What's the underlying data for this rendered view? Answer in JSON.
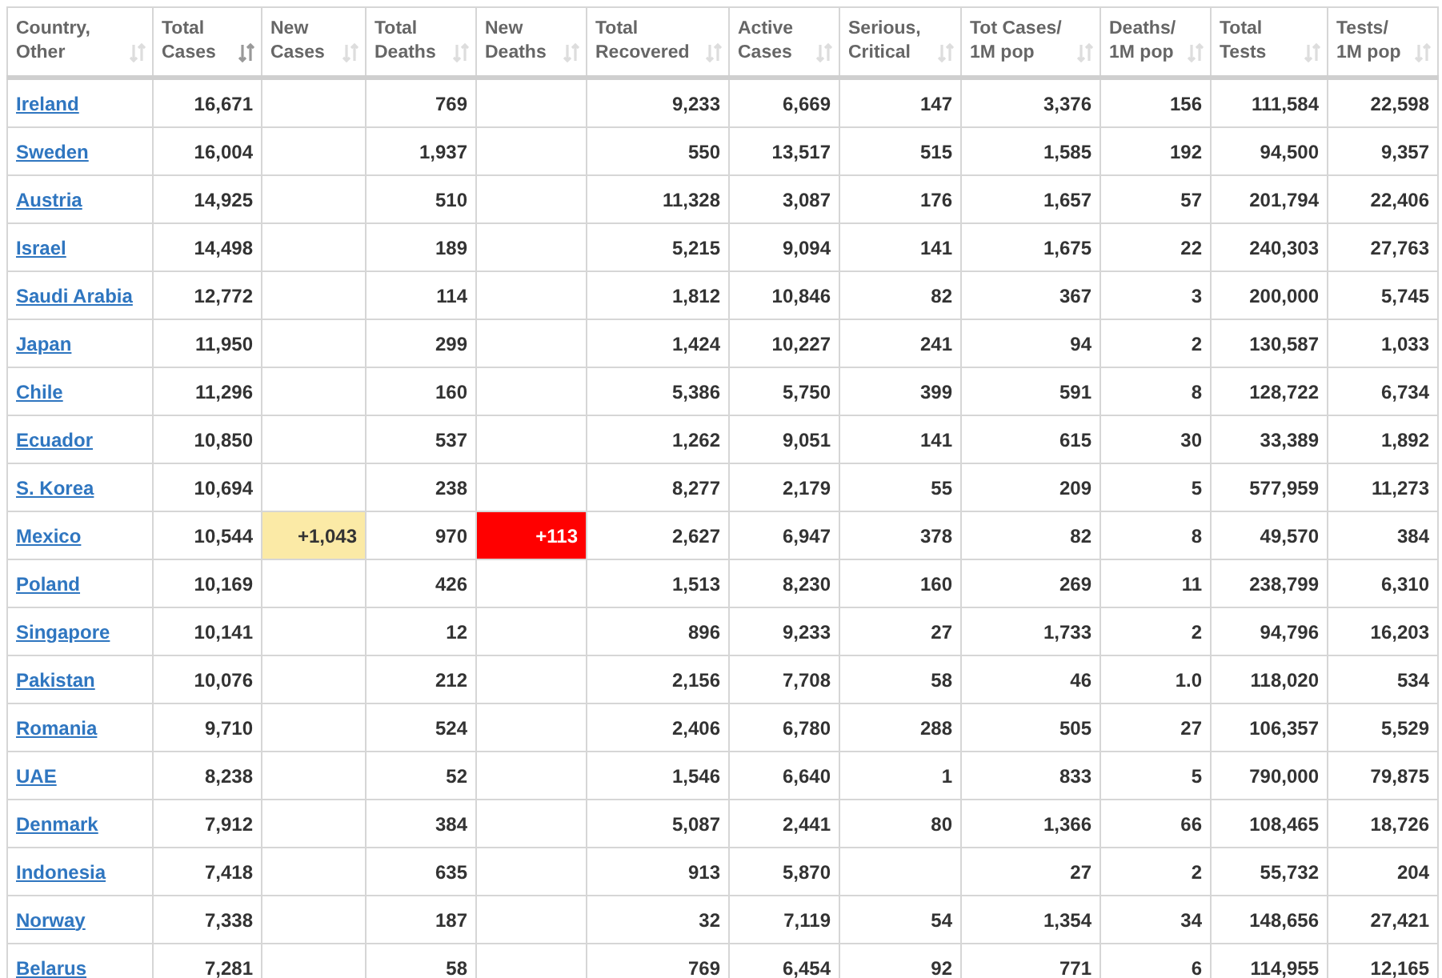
{
  "table": {
    "columns": [
      {
        "label": "Country,\nOther",
        "kind": "country",
        "sorted": false
      },
      {
        "label": "Total\nCases",
        "kind": "number",
        "sorted": true
      },
      {
        "label": "New\nCases",
        "kind": "new_cases",
        "sorted": false
      },
      {
        "label": "Total\nDeaths",
        "kind": "number",
        "sorted": false
      },
      {
        "label": "New\nDeaths",
        "kind": "new_deaths",
        "sorted": false
      },
      {
        "label": "Total\nRecovered",
        "kind": "number",
        "sorted": false
      },
      {
        "label": "Active\nCases",
        "kind": "number",
        "sorted": false
      },
      {
        "label": "Serious,\nCritical",
        "kind": "number",
        "sorted": false
      },
      {
        "label": "Tot Cases/\n1M pop",
        "kind": "number",
        "sorted": false
      },
      {
        "label": "Deaths/\n1M pop",
        "kind": "number",
        "sorted": false
      },
      {
        "label": "Total\nTests",
        "kind": "number",
        "sorted": false
      },
      {
        "label": "Tests/\n1M pop",
        "kind": "number",
        "sorted": false
      }
    ],
    "rows": [
      [
        "Ireland",
        "16,671",
        null,
        "769",
        null,
        "9,233",
        "6,669",
        "147",
        "3,376",
        "156",
        "111,584",
        "22,598"
      ],
      [
        "Sweden",
        "16,004",
        null,
        "1,937",
        null,
        "550",
        "13,517",
        "515",
        "1,585",
        "192",
        "94,500",
        "9,357"
      ],
      [
        "Austria",
        "14,925",
        null,
        "510",
        null,
        "11,328",
        "3,087",
        "176",
        "1,657",
        "57",
        "201,794",
        "22,406"
      ],
      [
        "Israel",
        "14,498",
        null,
        "189",
        null,
        "5,215",
        "9,094",
        "141",
        "1,675",
        "22",
        "240,303",
        "27,763"
      ],
      [
        "Saudi Arabia",
        "12,772",
        null,
        "114",
        null,
        "1,812",
        "10,846",
        "82",
        "367",
        "3",
        "200,000",
        "5,745"
      ],
      [
        "Japan",
        "11,950",
        null,
        "299",
        null,
        "1,424",
        "10,227",
        "241",
        "94",
        "2",
        "130,587",
        "1,033"
      ],
      [
        "Chile",
        "11,296",
        null,
        "160",
        null,
        "5,386",
        "5,750",
        "399",
        "591",
        "8",
        "128,722",
        "6,734"
      ],
      [
        "Ecuador",
        "10,850",
        null,
        "537",
        null,
        "1,262",
        "9,051",
        "141",
        "615",
        "30",
        "33,389",
        "1,892"
      ],
      [
        "S. Korea",
        "10,694",
        null,
        "238",
        null,
        "8,277",
        "2,179",
        "55",
        "209",
        "5",
        "577,959",
        "11,273"
      ],
      [
        "Mexico",
        "10,544",
        "+1,043",
        "970",
        "+113",
        "2,627",
        "6,947",
        "378",
        "82",
        "8",
        "49,570",
        "384"
      ],
      [
        "Poland",
        "10,169",
        null,
        "426",
        null,
        "1,513",
        "8,230",
        "160",
        "269",
        "11",
        "238,799",
        "6,310"
      ],
      [
        "Singapore",
        "10,141",
        null,
        "12",
        null,
        "896",
        "9,233",
        "27",
        "1,733",
        "2",
        "94,796",
        "16,203"
      ],
      [
        "Pakistan",
        "10,076",
        null,
        "212",
        null,
        "2,156",
        "7,708",
        "58",
        "46",
        "1.0",
        "118,020",
        "534"
      ],
      [
        "Romania",
        "9,710",
        null,
        "524",
        null,
        "2,406",
        "6,780",
        "288",
        "505",
        "27",
        "106,357",
        "5,529"
      ],
      [
        "UAE",
        "8,238",
        null,
        "52",
        null,
        "1,546",
        "6,640",
        "1",
        "833",
        "5",
        "790,000",
        "79,875"
      ],
      [
        "Denmark",
        "7,912",
        null,
        "384",
        null,
        "5,087",
        "2,441",
        "80",
        "1,366",
        "66",
        "108,465",
        "18,726"
      ],
      [
        "Indonesia",
        "7,418",
        null,
        "635",
        null,
        "913",
        "5,870",
        null,
        "27",
        "2",
        "55,732",
        "204"
      ],
      [
        "Norway",
        "7,338",
        null,
        "187",
        null,
        "32",
        "7,119",
        "54",
        "1,354",
        "34",
        "148,656",
        "27,421"
      ],
      [
        "Belarus",
        "7,281",
        null,
        "58",
        null,
        "769",
        "6,454",
        "92",
        "771",
        "6",
        "114,955",
        "12,165"
      ]
    ]
  }
}
